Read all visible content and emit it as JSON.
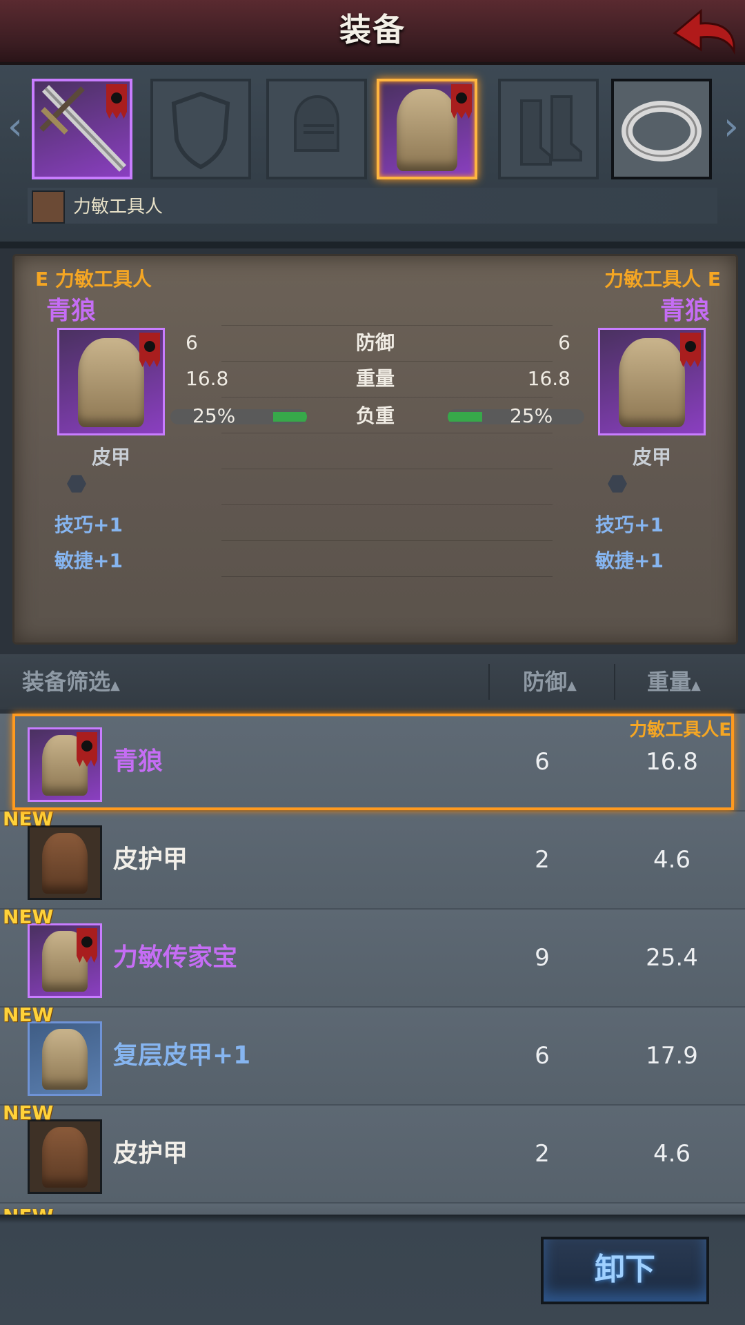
{
  "header": {
    "title": "装备"
  },
  "character": {
    "name": "力敏工具人"
  },
  "compare": {
    "left": {
      "equip_tag": "E 力敏工具人",
      "item_name": "青狼",
      "type": "皮甲",
      "defense": "6",
      "weight": "16.8",
      "load": "25%",
      "load_fraction": 0.25,
      "bonus1": "技巧+1",
      "bonus2": "敏捷+1"
    },
    "right": {
      "equip_tag": "力敏工具人 E",
      "item_name": "青狼",
      "type": "皮甲",
      "defense": "6",
      "weight": "16.8",
      "load": "25%",
      "load_fraction": 0.25,
      "bonus1": "技巧+1",
      "bonus2": "敏捷+1"
    },
    "labels": {
      "defense": "防御",
      "weight": "重量",
      "load": "负重"
    }
  },
  "list_header": {
    "filter": "装备筛选",
    "defense": "防御",
    "weight": "重量"
  },
  "items": [
    {
      "name": "青狼",
      "defense": "6",
      "weight": "16.8",
      "rarity": "purple",
      "new": "",
      "equipped": "力敏工具人E"
    },
    {
      "name": "皮护甲",
      "defense": "2",
      "weight": "4.6",
      "rarity": "common",
      "new": "NEW"
    },
    {
      "name": "力敏传家宝",
      "defense": "9",
      "weight": "25.4",
      "rarity": "purple",
      "new": "NEW"
    },
    {
      "name": "复层皮甲+1",
      "defense": "6",
      "weight": "17.9",
      "rarity": "blue",
      "new": "NEW"
    },
    {
      "name": "皮护甲",
      "defense": "2",
      "weight": "4.6",
      "rarity": "common",
      "new": "NEW"
    }
  ],
  "cutoff_badge": "NEW",
  "actions": {
    "unequip": "卸下"
  },
  "colors": {
    "accent_orange": "#f5a623",
    "rarity_purple": "#c56df4",
    "rarity_blue": "#86b5f0",
    "new_badge": "#ffd23a"
  }
}
